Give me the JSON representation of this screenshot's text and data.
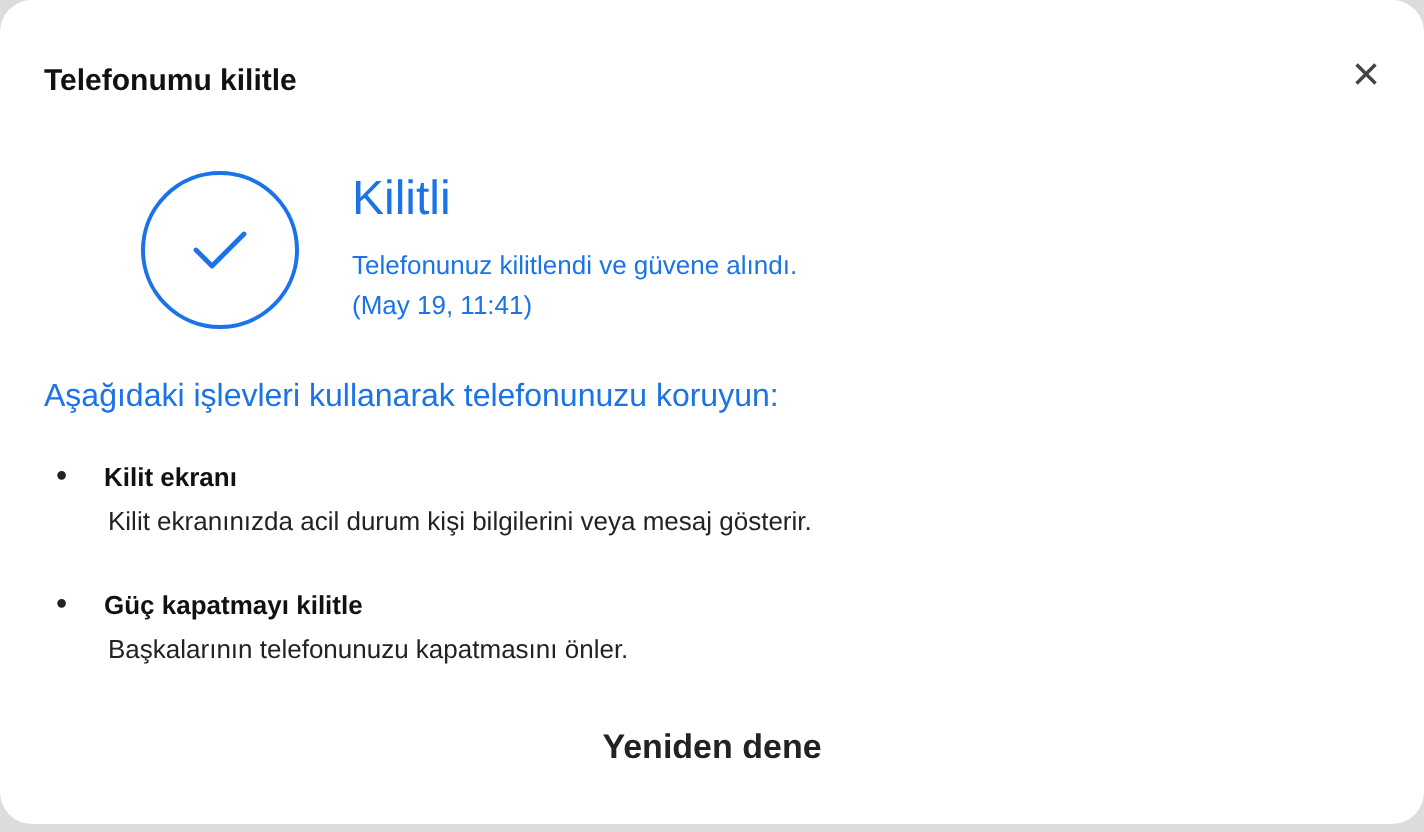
{
  "dialog": {
    "title": "Telefonumu kilitle",
    "close": "×"
  },
  "status": {
    "heading": "Kilitli",
    "message": "Telefonunuz kilitlendi ve güvene alındı.",
    "time": "(May 19, 11:41)"
  },
  "section_heading": "Aşağıdaki işlevleri kullanarak telefonunuzu koruyun:",
  "features": [
    {
      "bullet": "•",
      "title": "Kilit ekranı",
      "description": "Kilit ekranınızda acil durum kişi bilgilerini veya mesaj gösterir."
    },
    {
      "bullet": "•",
      "title": "Güç kapatmayı kilitle",
      "description": "Başkalarının telefonunuzu kapatmasını önler."
    }
  ],
  "buttons": [
    "Yeniden dene"
  ]
}
